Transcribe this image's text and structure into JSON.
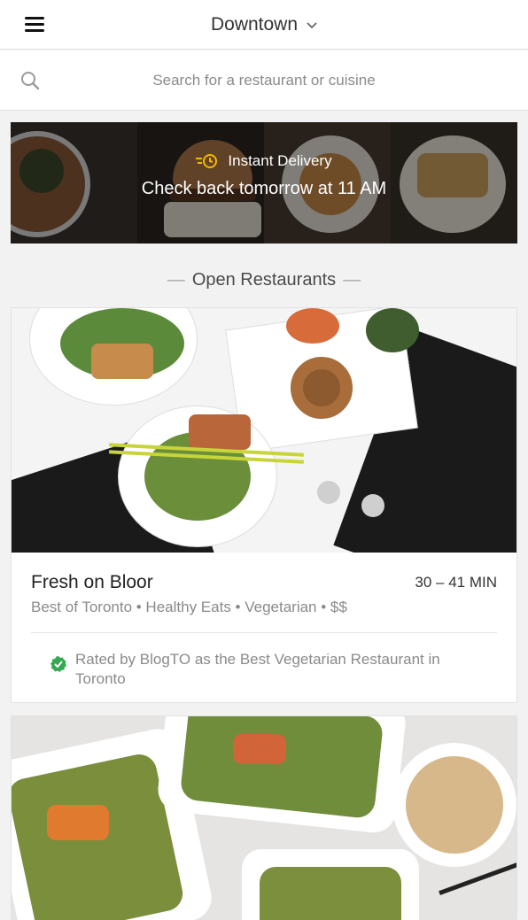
{
  "header": {
    "location": "Downtown",
    "menu_icon": "hamburger-menu-icon",
    "chevron_icon": "chevron-down-icon"
  },
  "search": {
    "placeholder": "Search for a restaurant or cuisine",
    "icon": "search-icon"
  },
  "promo": {
    "title": "Instant Delivery",
    "subtitle": "Check back tomorrow at 11 AM",
    "icon": "fast-clock-icon",
    "accent": "#f5b800"
  },
  "section": {
    "title": "Open Restaurants"
  },
  "restaurants": [
    {
      "name": "Fresh on Bloor",
      "eta": "30 – 41 MIN",
      "tags": "Best of Toronto • Healthy Eats • Vegetarian • $$",
      "rating_note": "Rated by BlogTO as the Best Vegetarian Restaurant in Toronto",
      "check_color": "#35a852"
    },
    {
      "name": "",
      "eta": "",
      "tags": ""
    }
  ]
}
